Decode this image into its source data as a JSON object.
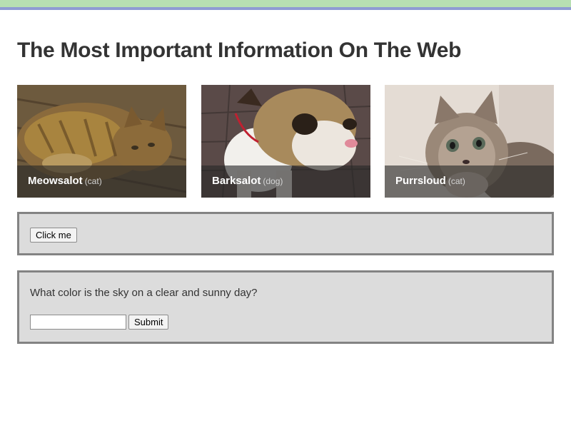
{
  "page": {
    "title": "The Most Important Information On The Web"
  },
  "theme": {
    "top_bar_green": "#b7dfb2",
    "top_bar_blue": "#8f9bd3",
    "panel_background": "#dcdcdc",
    "panel_border": "#838383"
  },
  "cards": [
    {
      "name": "Meowsalot",
      "kind": "(cat)",
      "image": "tabby-cat-photo"
    },
    {
      "name": "Barksalot",
      "kind": "(dog)",
      "image": "bulldog-photo"
    },
    {
      "name": "Purrsloud",
      "kind": "(cat)",
      "image": "kitten-photo"
    }
  ],
  "button_panel": {
    "button_label": "Click me"
  },
  "quiz": {
    "question": "What color is the sky on a clear and sunny day?",
    "answer_value": "",
    "answer_placeholder": "",
    "submit_label": "Submit"
  }
}
